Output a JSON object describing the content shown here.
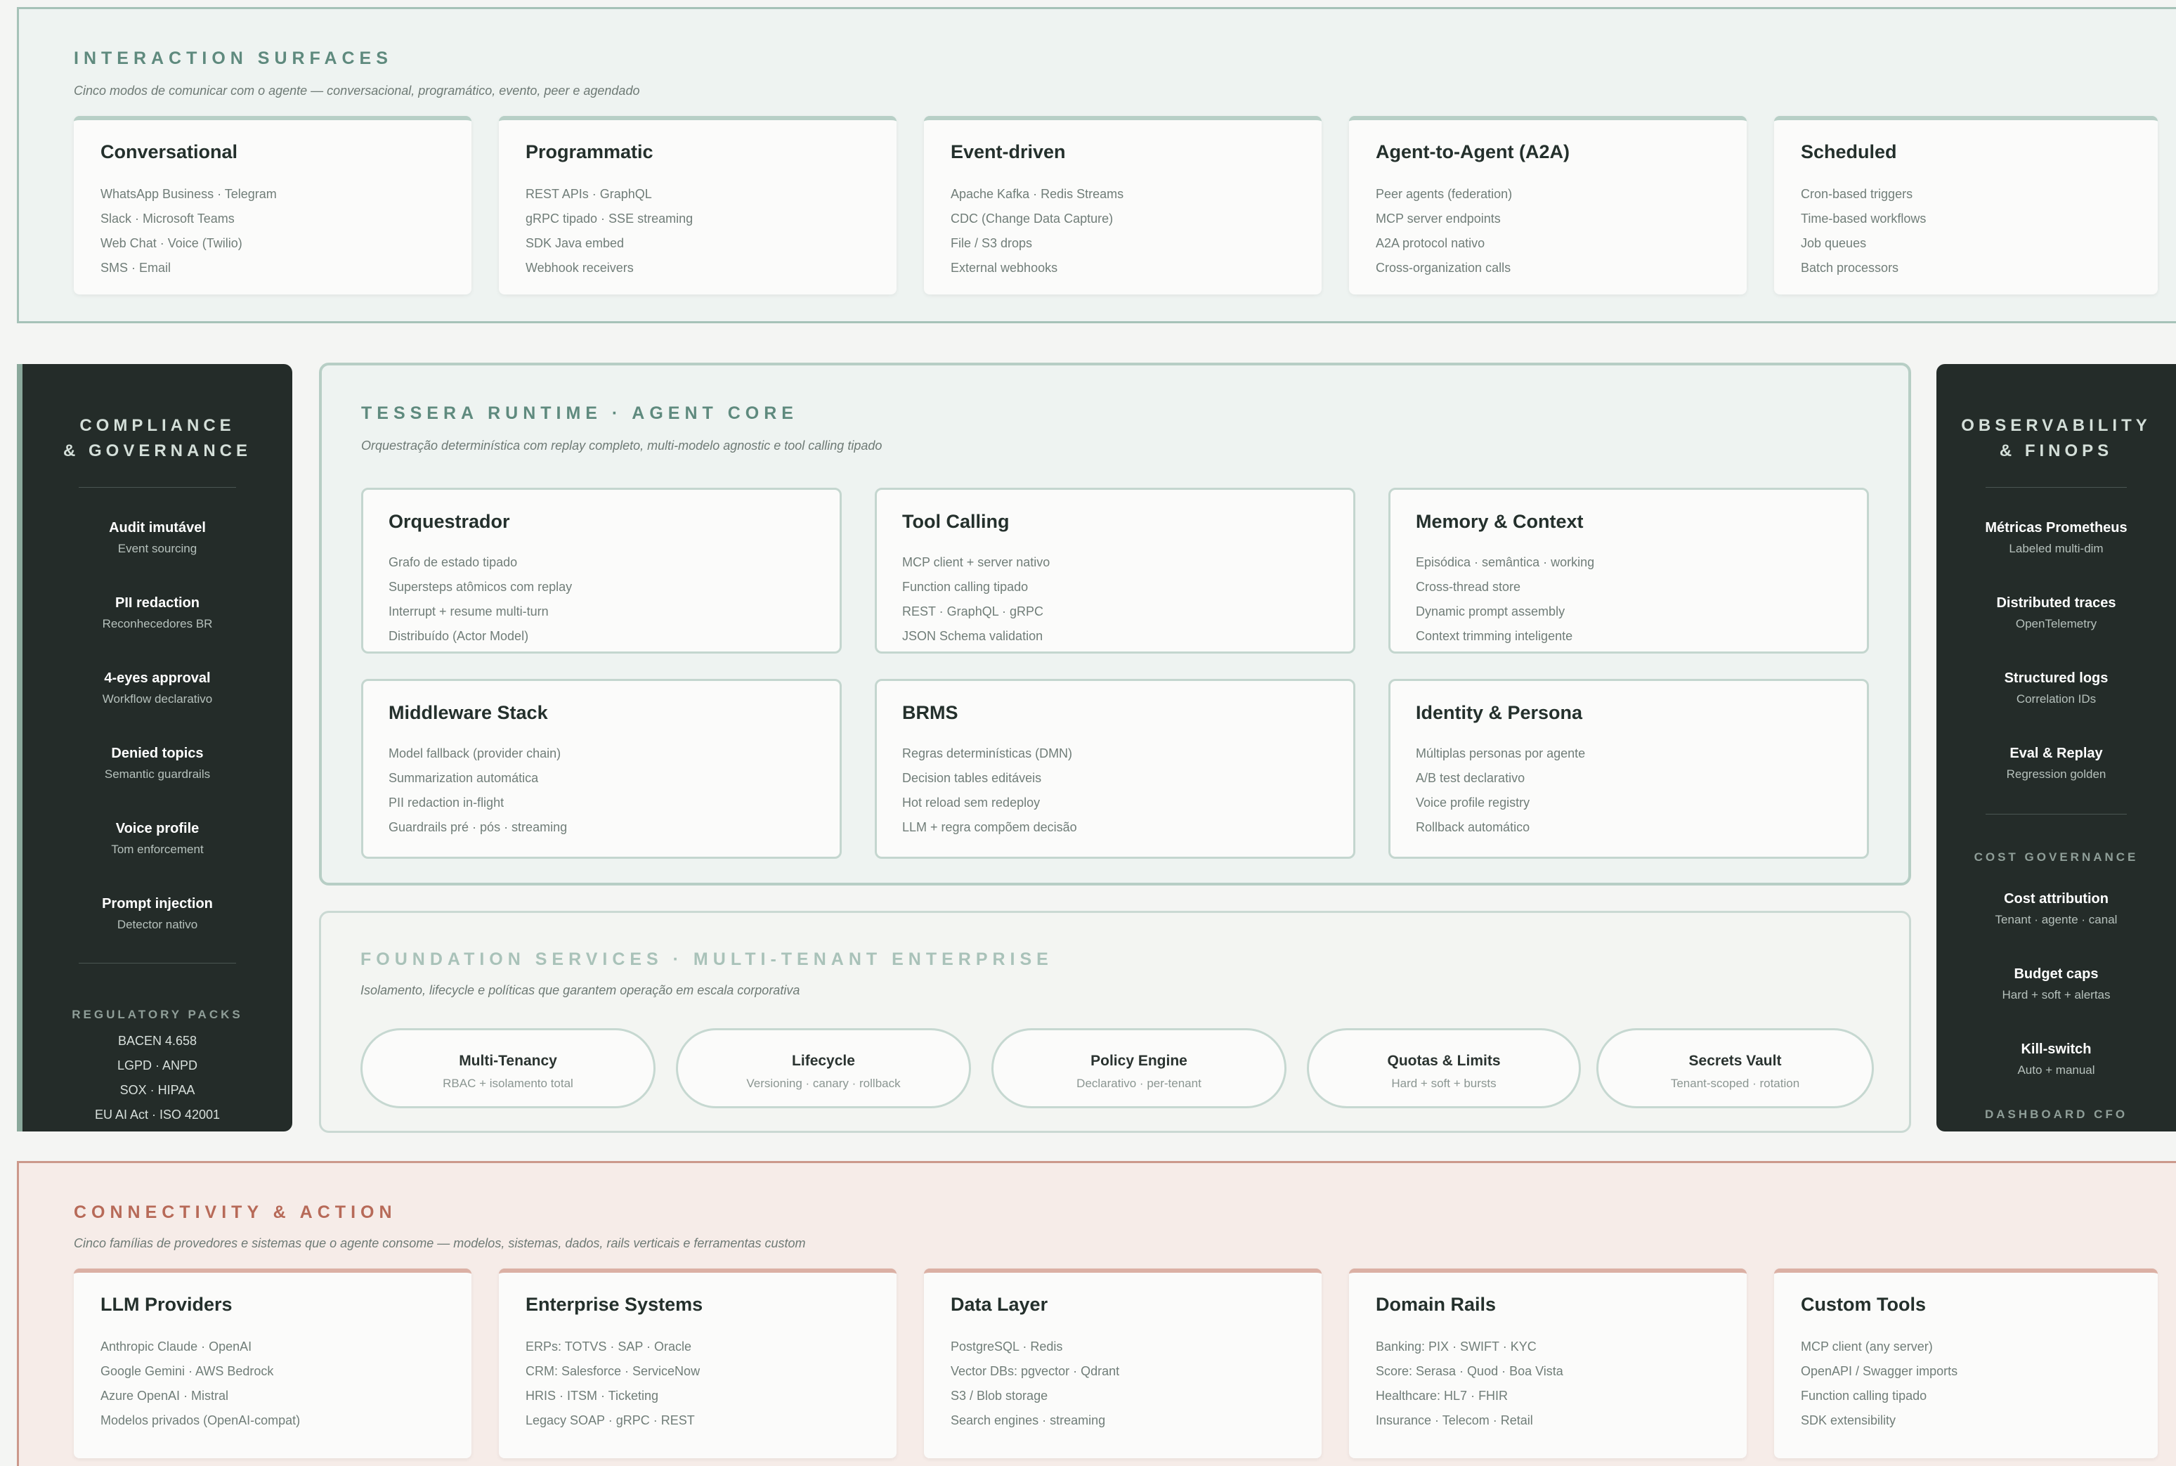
{
  "interaction": {
    "kicker": "INTERACTION SURFACES",
    "subtitle": "Cinco modos de comunicar com o agente — conversacional, programático, evento, peer e agendado",
    "cards": [
      {
        "title": "Conversational",
        "lines": [
          "WhatsApp Business · Telegram",
          "Slack · Microsoft Teams",
          "Web Chat · Voice (Twilio)",
          "SMS · Email"
        ]
      },
      {
        "title": "Programmatic",
        "lines": [
          "REST APIs · GraphQL",
          "gRPC tipado · SSE streaming",
          "SDK Java embed",
          "Webhook receivers"
        ]
      },
      {
        "title": "Event-driven",
        "lines": [
          "Apache Kafka · Redis Streams",
          "CDC (Change Data Capture)",
          "File / S3 drops",
          "External webhooks"
        ]
      },
      {
        "title": "Agent-to-Agent (A2A)",
        "lines": [
          "Peer agents (federation)",
          "MCP server endpoints",
          "A2A protocol nativo",
          "Cross-organization calls"
        ]
      },
      {
        "title": "Scheduled",
        "lines": [
          "Cron-based triggers",
          "Time-based workflows",
          "Job queues",
          "Batch processors"
        ]
      }
    ]
  },
  "compliance": {
    "heading_1": "COMPLIANCE",
    "heading_2": "& GOVERNANCE",
    "items": [
      {
        "title": "Audit imutável",
        "sub": "Event sourcing"
      },
      {
        "title": "PII redaction",
        "sub": "Reconhecedores BR"
      },
      {
        "title": "4-eyes approval",
        "sub": "Workflow declarativo"
      },
      {
        "title": "Denied topics",
        "sub": "Semantic guardrails"
      },
      {
        "title": "Voice profile",
        "sub": "Tom enforcement"
      },
      {
        "title": "Prompt injection",
        "sub": "Detector nativo"
      }
    ],
    "packs_label": "REGULATORY PACKS",
    "packs": [
      "BACEN 4.658",
      "LGPD · ANPD",
      "SOX · HIPAA",
      "EU AI Act · ISO 42001"
    ]
  },
  "runtime": {
    "kicker": "TESSERA RUNTIME · AGENT CORE",
    "subtitle": "Orquestração determinística com replay completo, multi-modelo agnostic e tool calling tipado",
    "cards": [
      {
        "title": "Orquestrador",
        "lines": [
          "Grafo de estado tipado",
          "Supersteps atômicos com replay",
          "Interrupt + resume multi-turn",
          "Distribuído (Actor Model)"
        ]
      },
      {
        "title": "Tool Calling",
        "lines": [
          "MCP client + server nativo",
          "Function calling tipado",
          "REST · GraphQL · gRPC",
          "JSON Schema validation"
        ]
      },
      {
        "title": "Memory & Context",
        "lines": [
          "Episódica · semântica · working",
          "Cross-thread store",
          "Dynamic prompt assembly",
          "Context trimming inteligente"
        ]
      },
      {
        "title": "Middleware Stack",
        "lines": [
          "Model fallback (provider chain)",
          "Summarization automática",
          "PII redaction in-flight",
          "Guardrails pré · pós · streaming"
        ]
      },
      {
        "title": "BRMS",
        "lines": [
          "Regras determinísticas (DMN)",
          "Decision tables editáveis",
          "Hot reload sem redeploy",
          "LLM + regra compõem decisão"
        ]
      },
      {
        "title": "Identity & Persona",
        "lines": [
          "Múltiplas personas por agente",
          "A/B test declarativo",
          "Voice profile registry",
          "Rollback automático"
        ]
      }
    ]
  },
  "foundation": {
    "kicker": "FOUNDATION SERVICES · MULTI-TENANT ENTERPRISE",
    "subtitle": "Isolamento, lifecycle e políticas que garantem operação em escala corporativa",
    "pills": [
      {
        "title": "Multi-Tenancy",
        "sub": "RBAC + isolamento total"
      },
      {
        "title": "Lifecycle",
        "sub": "Versioning · canary · rollback"
      },
      {
        "title": "Policy Engine",
        "sub": "Declarativo · per-tenant"
      },
      {
        "title": "Quotas & Limits",
        "sub": "Hard + soft + bursts"
      },
      {
        "title": "Secrets Vault",
        "sub": "Tenant-scoped · rotation"
      }
    ]
  },
  "observability": {
    "heading_1": "OBSERVABILITY",
    "heading_2": "& FINOPS",
    "items": [
      {
        "title": "Métricas Prometheus",
        "sub": "Labeled multi-dim"
      },
      {
        "title": "Distributed traces",
        "sub": "OpenTelemetry"
      },
      {
        "title": "Structured logs",
        "sub": "Correlation IDs"
      },
      {
        "title": "Eval & Replay",
        "sub": "Regression golden"
      }
    ],
    "cost_label": "COST GOVERNANCE",
    "cost_items": [
      {
        "title": "Cost attribution",
        "sub": "Tenant · agente · canal"
      },
      {
        "title": "Budget caps",
        "sub": "Hard + soft + alertas"
      },
      {
        "title": "Kill-switch",
        "sub": "Auto + manual"
      }
    ],
    "footer": "DASHBOARD CFO"
  },
  "connectivity": {
    "kicker": "CONNECTIVITY & ACTION",
    "subtitle": "Cinco famílias de provedores e sistemas que o agente consome — modelos, sistemas, dados, rails verticais e ferramentas custom",
    "cards": [
      {
        "title": "LLM Providers",
        "lines": [
          "Anthropic Claude · OpenAI",
          "Google Gemini · AWS Bedrock",
          "Azure OpenAI · Mistral",
          "Modelos privados (OpenAI-compat)"
        ]
      },
      {
        "title": "Enterprise Systems",
        "lines": [
          "ERPs: TOTVS · SAP · Oracle",
          "CRM: Salesforce · ServiceNow",
          "HRIS · ITSM · Ticketing",
          "Legacy SOAP · gRPC · REST"
        ]
      },
      {
        "title": "Data Layer",
        "lines": [
          "PostgreSQL · Redis",
          "Vector DBs: pgvector · Qdrant",
          "S3 / Blob storage",
          "Search engines · streaming"
        ]
      },
      {
        "title": "Domain Rails",
        "lines": [
          "Banking: PIX · SWIFT · KYC",
          "Score: Serasa · Quod · Boa Vista",
          "Healthcare: HL7 · FHIR",
          "Insurance · Telecom · Retail"
        ]
      },
      {
        "title": "Custom Tools",
        "lines": [
          "MCP client (any server)",
          "OpenAPI / Swagger imports",
          "Function calling tipado",
          "SDK extensibility"
        ]
      }
    ]
  },
  "colors": {
    "green_accent": "#5f8a7e",
    "red_accent": "#b76a58",
    "dark_panel": "#242c29"
  }
}
